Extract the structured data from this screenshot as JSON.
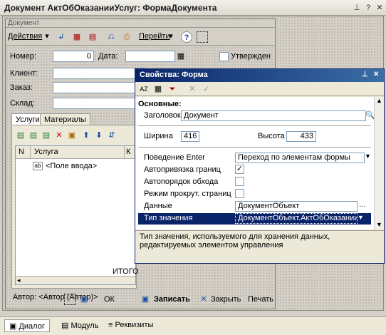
{
  "window": {
    "title": "Документ АктОбОказанииУслуг: ФормаДокумента"
  },
  "form": {
    "caption": "Документ",
    "toolbar": {
      "actions": "Действия",
      "goto": "Перейти"
    },
    "fields": {
      "number_label": "Номер:",
      "number_value": "0",
      "date_label": "Дата:",
      "approved_label": "Утвержден",
      "client_label": "Клиент:",
      "order_label": "Заказ:",
      "warehouse_label": "Склад:"
    },
    "tabs": [
      "Услуги",
      "Материалы"
    ],
    "grid": {
      "columns": [
        "N",
        "Услуга",
        "К"
      ],
      "row_field": "<Поле ввода>",
      "total_label": "ИТОГО"
    },
    "author": "Автор:  <Автор (Автор)>",
    "buttons": {
      "ok": "ОК",
      "save": "Записать",
      "close": "Закрыть",
      "print": "Печать"
    }
  },
  "props": {
    "title": "Свойства: Форма",
    "section": "Основные:",
    "header_label": "Заголовок",
    "header_value": "Документ",
    "width_label": "Ширина",
    "width_value": "416",
    "height_label": "Высота",
    "height_value": "433",
    "enter_label": "Поведение Enter",
    "enter_value": "Переход по элементам формы",
    "autoframe_label": "Автопривязка границ",
    "autoframe_checked": true,
    "autoorder_label": "Автопорядок обхода",
    "autoorder_checked": false,
    "scrollmode_label": "Режим прокрут. страниц",
    "scrollmode_checked": false,
    "data_label": "Данные",
    "data_value": "ДокументОбъект",
    "type_label": "Тип значения",
    "type_value": "ДокументОбъект.АктОбОказании",
    "hint": "Тип значения, используемого для хранения данных, редактируемых элементом управления"
  },
  "bottom_tabs": [
    "Диалог",
    "Модуль",
    "Реквизиты"
  ]
}
